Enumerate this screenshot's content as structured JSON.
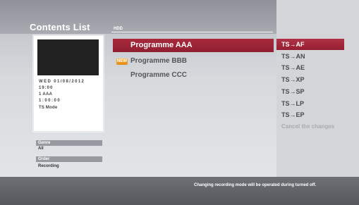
{
  "header": {
    "title": "Contents List",
    "tab_label": "HDD"
  },
  "info_card": {
    "date": "WED 01/08/2012",
    "time": "19:00",
    "channel": "1 AAA",
    "duration": "1:00:00",
    "mode": "TS Mode"
  },
  "filters": {
    "genre_label": "Genre",
    "genre_value": "All",
    "order_label": "Order",
    "order_value": "Recording"
  },
  "programmes": [
    {
      "title": "Programme AAA",
      "is_new": false,
      "selected": true
    },
    {
      "title": "Programme BBB",
      "is_new": true,
      "new_label": "NEW",
      "selected": false
    },
    {
      "title": "Programme CCC",
      "is_new": false,
      "selected": false
    }
  ],
  "mode_options": [
    {
      "label": "TS→AF",
      "selected": true
    },
    {
      "label": "TS→AN",
      "selected": false
    },
    {
      "label": "TS→AE",
      "selected": false
    },
    {
      "label": "TS→XP",
      "selected": false
    },
    {
      "label": "TS→SP",
      "selected": false
    },
    {
      "label": "TS→LP",
      "selected": false
    },
    {
      "label": "TS→EP",
      "selected": false
    },
    {
      "label": "Cancel the changes",
      "disabled": true
    }
  ],
  "status_message": "Changing recording mode will be operated during turned off.",
  "colors": {
    "selection": "#9b2235",
    "new_badge": "#f0a02a",
    "bottom_bar": "#606367"
  }
}
